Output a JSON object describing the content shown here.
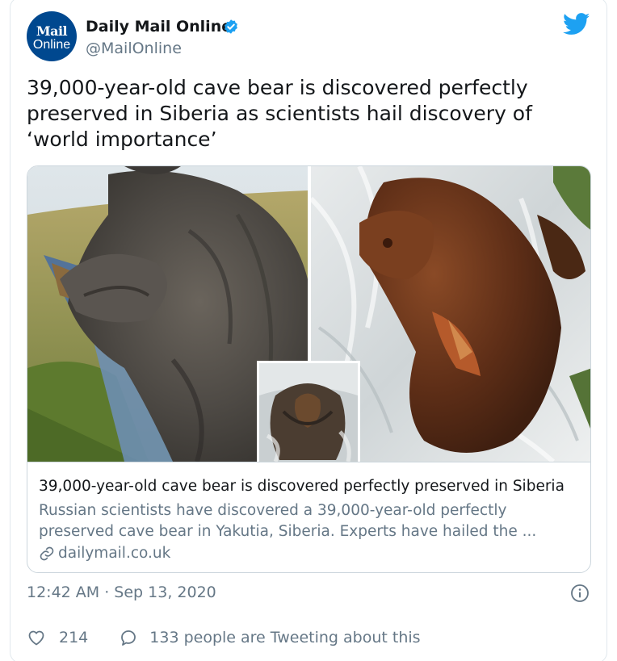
{
  "account": {
    "avatar_line1": "Mail",
    "avatar_line2": "Online",
    "name": "Daily Mail Online",
    "handle": "@MailOnline",
    "verified": true
  },
  "tweet": {
    "text": "39,000-year-old cave bear is discovered perfectly preserved in Siberia as scientists hail discovery of ‘world importance’"
  },
  "link_card": {
    "title": "39,000-year-old cave bear is discovered perfectly preserved in Siberia",
    "description": "Russian scientists have discovered a 39,000-year-old perfectly preserved cave bear in Yakutia, Siberia. Experts have hailed the ...",
    "domain": "dailymail.co.uk"
  },
  "meta": {
    "timestamp": "12:42 AM · Sep 13, 2020"
  },
  "actions": {
    "likes": "214",
    "conversation": "133 people are Tweeting about this"
  },
  "colors": {
    "twitter_blue": "#1da1f2",
    "avatar_blue": "#00488f",
    "secondary_text": "#657786",
    "primary_text": "#14171a",
    "border": "#e1e8ed"
  },
  "icons": [
    "verified-icon",
    "twitter-bird-icon",
    "link-icon",
    "info-icon",
    "heart-icon",
    "speech-bubble-icon"
  ]
}
